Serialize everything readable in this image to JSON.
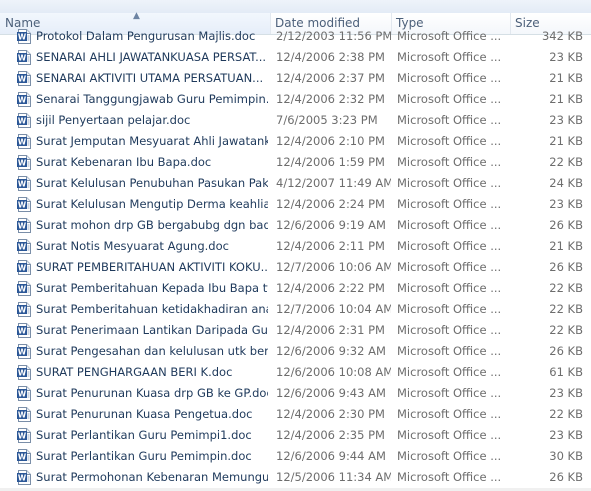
{
  "colors": {
    "name_text": "#1e395b",
    "detail_text": "#6d6d6d",
    "header_text": "#4c607a",
    "word_icon_blue": "#2b5797"
  },
  "header": {
    "name": "Name",
    "date_modified": "Date modified",
    "type": "Type",
    "size": "Size"
  },
  "files": [
    {
      "name": "Protokol Dalam Pengurusan Majlis.doc",
      "date": "2/12/2003 11:56 PM",
      "type": "Microsoft Office ...",
      "size": "342 KB",
      "icon": "word-doc-icon"
    },
    {
      "name": "SENARAI AHLI JAWATANKUASA PERSAT...",
      "date": "12/4/2006 2:38 PM",
      "type": "Microsoft Office ...",
      "size": "23 KB",
      "icon": "word-doc-icon"
    },
    {
      "name": "SENARAI AKTIVITI UTAMA PERSATUAN...",
      "date": "12/4/2006 2:37 PM",
      "type": "Microsoft Office ...",
      "size": "21 KB",
      "icon": "word-doc-icon"
    },
    {
      "name": "Senarai Tanggungjawab Guru Pemimpin...",
      "date": "12/4/2006 2:32 PM",
      "type": "Microsoft Office ...",
      "size": "21 KB",
      "icon": "word-doc-icon"
    },
    {
      "name": "sijil Penyertaan pelajar.doc",
      "date": "7/6/2005 3:23 PM",
      "type": "Microsoft Office ...",
      "size": "23 KB",
      "icon": "word-doc-icon"
    },
    {
      "name": "Surat Jemputan Mesyuarat Ahli Jawatank...",
      "date": "12/4/2006 2:10 PM",
      "type": "Microsoft Office ...",
      "size": "21 KB",
      "icon": "word-doc-icon"
    },
    {
      "name": "Surat Kebenaran Ibu Bapa.doc",
      "date": "12/4/2006 1:59 PM",
      "type": "Microsoft Office ...",
      "size": "22 KB",
      "icon": "word-doc-icon"
    },
    {
      "name": "Surat Kelulusan  Penubuhan Pasukan Pak...",
      "date": "4/12/2007 11:49 AM",
      "type": "Microsoft Office ...",
      "size": "24 KB",
      "icon": "word-doc-icon"
    },
    {
      "name": "Surat Kelulusan Mengutip Derma keahlia...",
      "date": "12/4/2006 2:24 PM",
      "type": "Microsoft Office ...",
      "size": "23 KB",
      "icon": "word-doc-icon"
    },
    {
      "name": "Surat mohon drp GB bergabubg dgn bad...",
      "date": "12/6/2006 9:19 AM",
      "type": "Microsoft Office ...",
      "size": "26 KB",
      "icon": "word-doc-icon"
    },
    {
      "name": "Surat Notis Mesyuarat Agung.doc",
      "date": "12/4/2006 2:11 PM",
      "type": "Microsoft Office ...",
      "size": "21 KB",
      "icon": "word-doc-icon"
    },
    {
      "name": "SURAT PEMBERITAHUAN AKTIVITI KOKU...",
      "date": "12/7/2006 10:06 AM",
      "type": "Microsoft Office ...",
      "size": "26 KB",
      "icon": "word-doc-icon"
    },
    {
      "name": "Surat Pemberitahuan Kepada Ibu Bapa tt...",
      "date": "12/4/2006 2:22 PM",
      "type": "Microsoft Office ...",
      "size": "22 KB",
      "icon": "word-doc-icon"
    },
    {
      "name": "Surat Pemberitahuan ketidakhadiran ana...",
      "date": "12/7/2006 10:04 AM",
      "type": "Microsoft Office ...",
      "size": "22 KB",
      "icon": "word-doc-icon"
    },
    {
      "name": "Surat Penerimaan Lantikan Daripada Gur...",
      "date": "12/4/2006 2:31 PM",
      "type": "Microsoft Office ...",
      "size": "22 KB",
      "icon": "word-doc-icon"
    },
    {
      "name": "Surat Pengesahan dan kelulusan utk berg...",
      "date": "12/6/2006 9:32 AM",
      "type": "Microsoft Office ...",
      "size": "26 KB",
      "icon": "word-doc-icon"
    },
    {
      "name": "SURAT PENGHARGAAN BERI K.doc",
      "date": "12/6/2006 10:08 AM",
      "type": "Microsoft Office ...",
      "size": "61 KB",
      "icon": "word-doc-icon"
    },
    {
      "name": "Surat Penurunan Kuasa drp GB ke GP.doc",
      "date": "12/6/2006 9:43 AM",
      "type": "Microsoft Office ...",
      "size": "23 KB",
      "icon": "word-doc-icon"
    },
    {
      "name": "Surat Penurunan Kuasa Pengetua.doc",
      "date": "12/4/2006 2:30 PM",
      "type": "Microsoft Office ...",
      "size": "22 KB",
      "icon": "word-doc-icon"
    },
    {
      "name": "Surat Perlantikan Guru Pemimpi1.doc",
      "date": "12/4/2006 2:35 PM",
      "type": "Microsoft Office ...",
      "size": "23 KB",
      "icon": "word-doc-icon"
    },
    {
      "name": "Surat Perlantikan Guru Pemimpin.doc",
      "date": "12/6/2006 9:44 AM",
      "type": "Microsoft Office ...",
      "size": "30 KB",
      "icon": "word-doc-icon"
    },
    {
      "name": "Surat Permohonan Kebenaran Memungu...",
      "date": "12/5/2006 11:34 AM",
      "type": "Microsoft Office ...",
      "size": "26 KB",
      "icon": "word-doc-icon"
    }
  ]
}
